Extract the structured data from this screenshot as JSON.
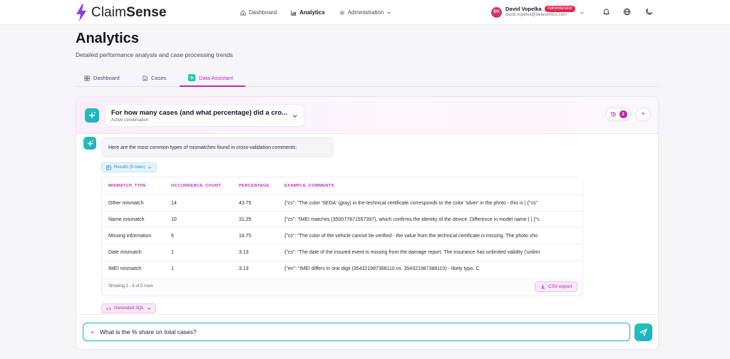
{
  "brand": {
    "name_light": "Claim",
    "name_bold": "Sense",
    "accent": "#7c3aed"
  },
  "nav": {
    "items": [
      {
        "label": "Dashboard",
        "icon": "home-icon"
      },
      {
        "label": "Analytics",
        "icon": "bar-chart-icon",
        "active": true
      },
      {
        "label": "Administration",
        "icon": "gear-icon"
      }
    ]
  },
  "user": {
    "initials": "DV",
    "name": "David Vopelka",
    "role": "Administrator",
    "email": "david.vopelka@datasentics.com"
  },
  "header": {
    "title": "Analytics",
    "subtitle": "Detailed performance analysis and case processing trends"
  },
  "tabs": [
    {
      "label": "Dashboard",
      "icon": "grid-icon"
    },
    {
      "label": "Cases",
      "icon": "document-icon"
    },
    {
      "label": "Data Assistant",
      "icon": "sparkle-icon",
      "active": true
    }
  ],
  "conversation": {
    "title": "For how many cases (and what percentage) did a cro...",
    "status": "Active conversation",
    "history_count": "2",
    "add_label": "+"
  },
  "message": {
    "text": "Here are the most common types of mismatches found in cross-validation comments:",
    "results_label": "Results (5 rows)",
    "sql_label": "Generated SQL"
  },
  "table": {
    "columns": [
      "MISMATCH_TYPE",
      "OCCURRENCE_COUNT",
      "PERCENTAGE",
      "EXAMPLE_COMMENTS"
    ],
    "rows": [
      [
        "Other mismatch",
        "14",
        "43.75",
        "{\"cs\": \"The color 'SEDA' (gray) in the technical certificate corresponds to the color 'silver' in the photo - this is | {\"cs\""
      ],
      [
        "Name mismatch",
        "10",
        "31.25",
        "{\"cs\": \"IMEI matches (350077871557397), which confirms the identity of the device. Difference in model name ( | {\"c"
      ],
      [
        "Missing information",
        "6",
        "18.75",
        "{\"cs\": \"The color of the vehicle cannot be verified - the value from the technical certificate is missing. The photo sho"
      ],
      [
        "Date mismatch",
        "1",
        "3.13",
        "{\"cs\": \"The date of the insured event is missing from the damage report. The insurance has unlimited validity ('unlimi"
      ],
      [
        "IMEI mismatch",
        "1",
        "3.13",
        "{\"en\": \"IMEI differs in one digit (354321987388110 vs. 354321987388110) - likely typo. C"
      ]
    ],
    "footer": "Showing 1 - 5 of 5 rows",
    "export_label": "CSV export"
  },
  "composer": {
    "value": "What is the % share on total cases?",
    "placeholder": ""
  }
}
